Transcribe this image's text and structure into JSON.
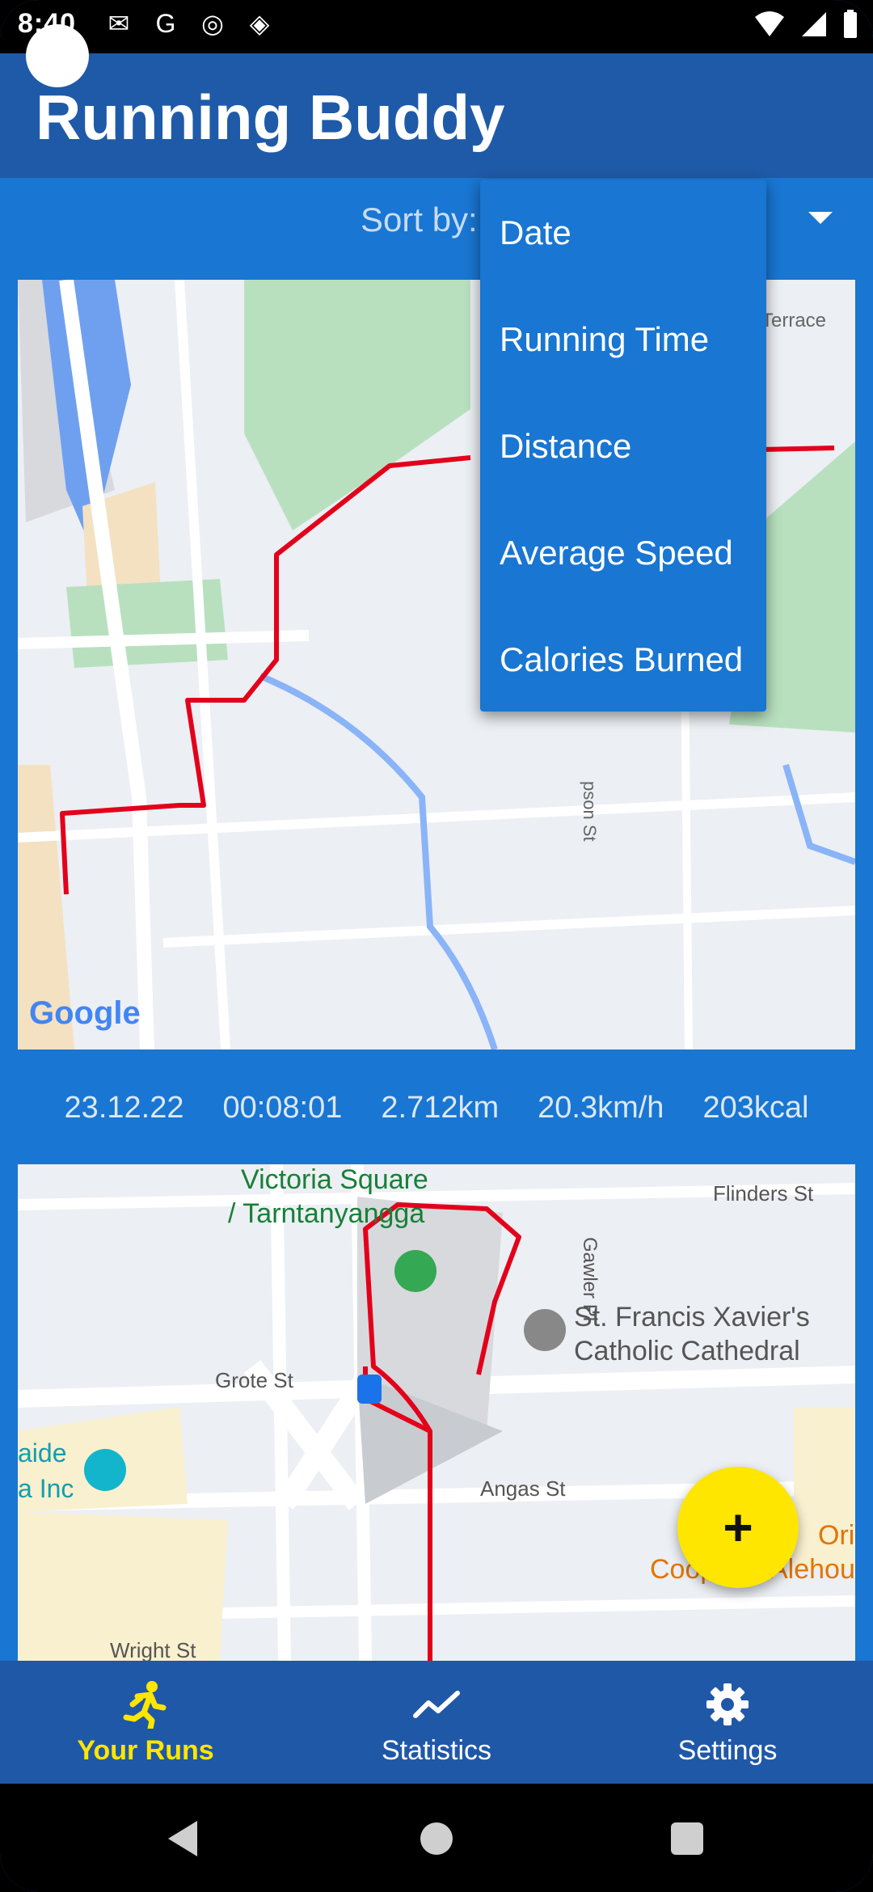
{
  "status_bar": {
    "time": "8:40"
  },
  "app": {
    "title": "Running Buddy"
  },
  "sort": {
    "label": "Sort by:",
    "options": [
      "Date",
      "Running Time",
      "Distance",
      "Average Speed",
      "Calories Burned"
    ]
  },
  "run1": {
    "date": "23.12.22",
    "time": "00:08:01",
    "distance": "2.712km",
    "speed": "20.3km/h",
    "calories": "203kcal",
    "map_labels": {
      "street": "Terrace",
      "street2": "pson St",
      "provider": "Google"
    }
  },
  "run2": {
    "map_labels": {
      "poi1": "Victoria Square",
      "poi1b": "/ Tarntanyangga",
      "poi2": "St. Francis Xavier's",
      "poi2b": "Catholic Cathedral",
      "st1": "Flinders St",
      "st2": "Grote St",
      "st3": "Angas St",
      "st4": "Wright St",
      "st5": "Gawler Pl",
      "poi3a": "aide",
      "poi3b": "a Inc",
      "poi4a": "Origi",
      "poi4b": "Coop",
      "poi4c": "Alehou"
    }
  },
  "fab": {
    "icon": "plus-icon"
  },
  "nav": {
    "items": [
      {
        "label": "Your Runs",
        "icon": "runner-icon"
      },
      {
        "label": "Statistics",
        "icon": "chart-line-icon"
      },
      {
        "label": "Settings",
        "icon": "gear-icon"
      }
    ]
  },
  "colors": {
    "primary": "#1976d2",
    "appbar": "#1f5aa8",
    "accent": "#ffe600",
    "route": "#e3001b"
  }
}
